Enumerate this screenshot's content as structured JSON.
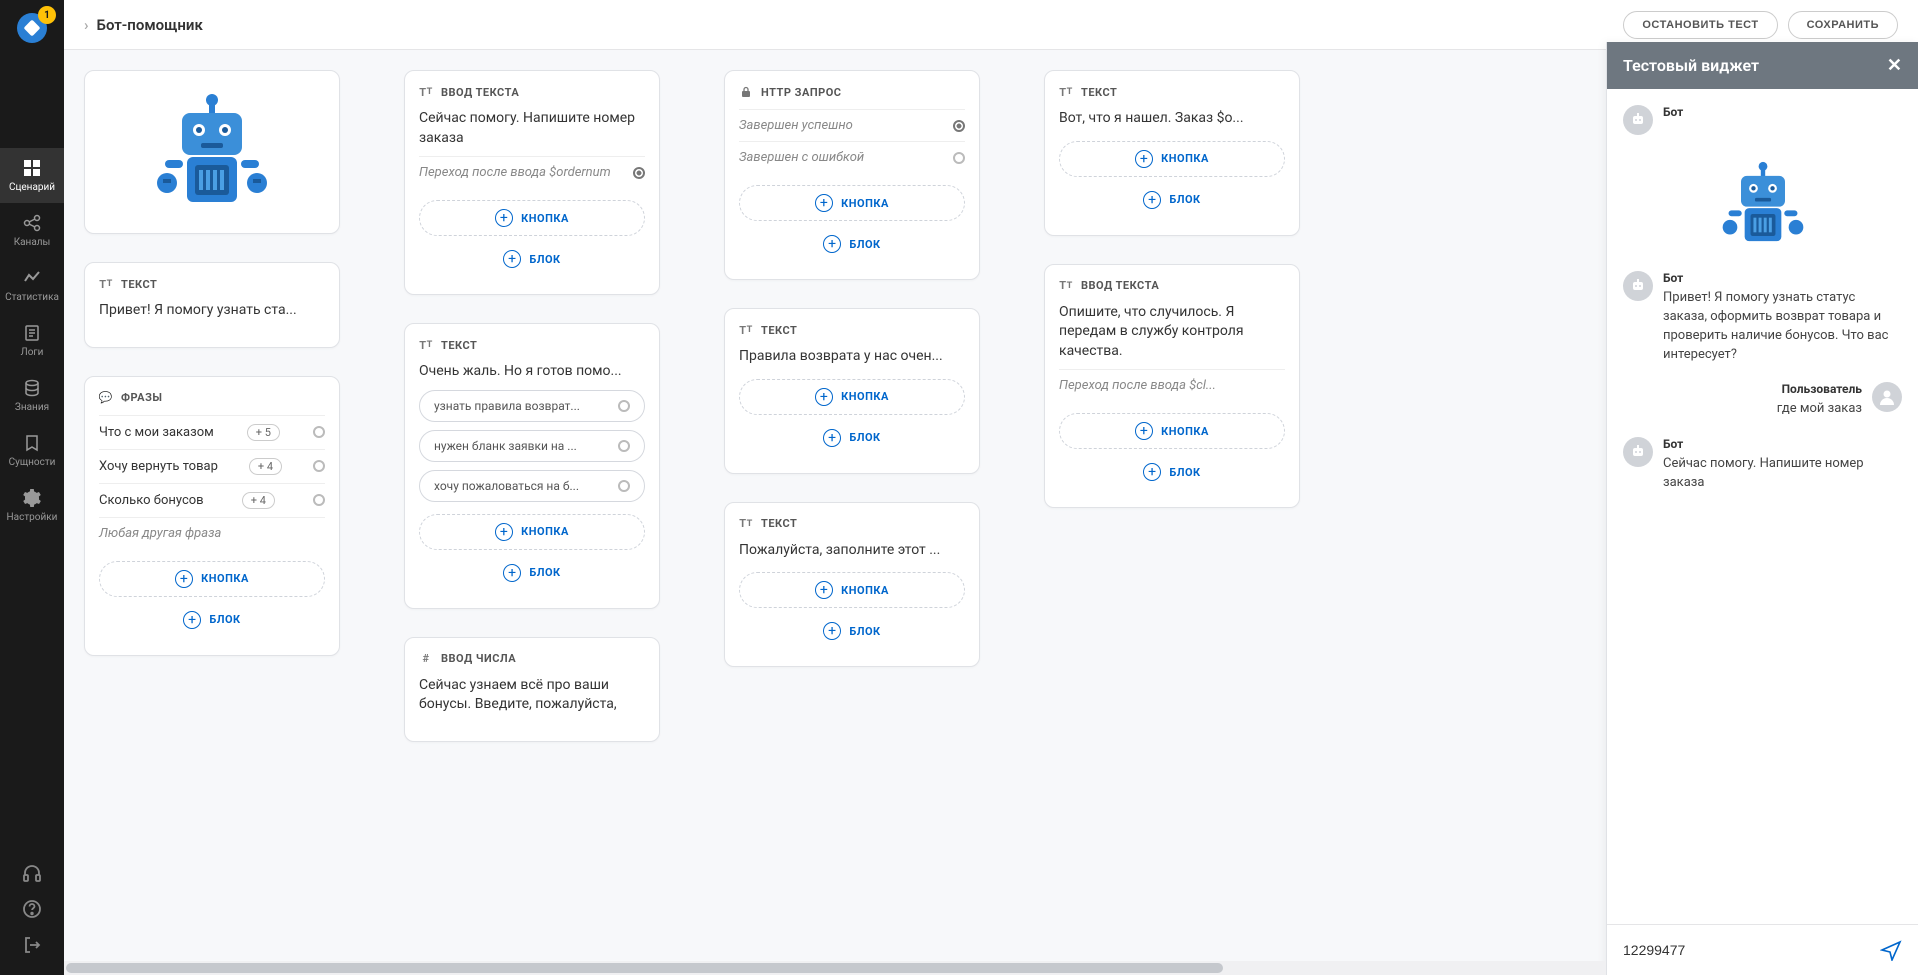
{
  "header": {
    "title": "Бот-помощник",
    "stop_test": "ОСТАНОВИТЬ ТЕСТ",
    "save": "СОХРАНИТЬ"
  },
  "sidebar": {
    "badge": "1",
    "items": [
      {
        "label": "Сценарий"
      },
      {
        "label": "Каналы"
      },
      {
        "label": "Статистика"
      },
      {
        "label": "Логи"
      },
      {
        "label": "Знания"
      },
      {
        "label": "Сущности"
      },
      {
        "label": "Настройки"
      }
    ]
  },
  "labels": {
    "text": "ТЕКСТ",
    "input_text": "ВВОД ТЕКСТА",
    "input_number": "ВВОД ЧИСЛА",
    "http": "HTTP ЗАПРОС",
    "phrases": "ФРАЗЫ",
    "button": "КНОПКА",
    "block": "БЛОК"
  },
  "col1": {
    "greeting": "Привет! Я помогу узнать ста...",
    "phrases": [
      {
        "text": "Что с мои заказом",
        "tag": "+ 5"
      },
      {
        "text": "Хочу вернуть товар",
        "tag": "+ 4"
      },
      {
        "text": "Сколько бонусов",
        "tag": "+ 4"
      }
    ],
    "any_phrase": "Любая другая фраза"
  },
  "col2": {
    "input1": "Сейчас помогу. Напишите номер заказа",
    "input1_sub": "Переход после ввода $ordernum",
    "text2": "Очень жаль. Но я готов помо...",
    "opts": [
      "узнать правила возврат...",
      "нужен бланк заявки на ...",
      "хочу пожаловаться на б..."
    ],
    "num": "Сейчас узнаем всё про ваши бонусы. Введите, пожалуйста,"
  },
  "col3": {
    "http_ok": "Завершен успешно",
    "http_err": "Завершен с ошибкой",
    "text1": "Правила возврата у нас очен...",
    "text2": "Пожалуйста, заполните этот ..."
  },
  "col4": {
    "text1": "Вот, что я нашел. Заказ $o...",
    "input2": "Опишите, что случилось. Я передам в службу контроля качества.",
    "input2_sub": "Переход после ввода $cl..."
  },
  "widget": {
    "title": "Тестовый виджет",
    "bot_name": "Бот",
    "user_name": "Пользователь",
    "msg1": "Привет! Я помогу узнать статус заказа, оформить возврат товара и проверить наличие бонусов. Что вас интересует?",
    "user_msg": "где мой заказ",
    "msg2": "Сейчас помогу. Напишите номер заказа",
    "input_value": "12299477"
  }
}
